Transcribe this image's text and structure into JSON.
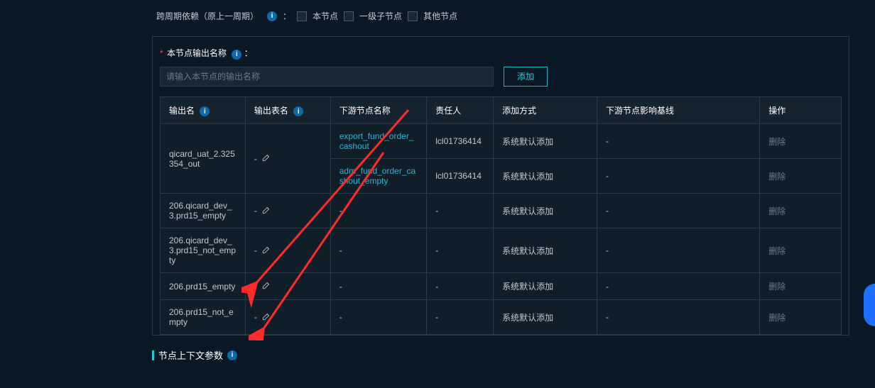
{
  "dep": {
    "label": "跨周期依赖（原上一周期）",
    "opts": [
      "本节点",
      "一级子节点",
      "其他节点"
    ]
  },
  "output": {
    "title": "本节点输出名称",
    "placeholder": "请输入本节点的输出名称",
    "add": "添加",
    "headers": {
      "outname": "输出名",
      "outtable": "输出表名",
      "downnode": "下游节点名称",
      "owner": "责任人",
      "addmode": "添加方式",
      "baseline": "下游节点影响基线",
      "op": "操作"
    },
    "op_delete": "删除",
    "rows": [
      {
        "outname": "qicard_uat_2.325354_out",
        "outtable": "-",
        "down": [
          {
            "node": "export_fund_order_cashout",
            "owner": "lcl01736414",
            "addmode": "系统默认添加",
            "baseline": "-"
          },
          {
            "node": "adm_fund_order_cashout_empty",
            "owner": "lcl01736414",
            "addmode": "系统默认添加",
            "baseline": "-"
          }
        ]
      },
      {
        "outname": "206.qicard_dev_3.prd15_empty",
        "outtable": "-",
        "down": [
          {
            "node": "-",
            "owner": "-",
            "addmode": "系统默认添加",
            "baseline": "-"
          }
        ]
      },
      {
        "outname": "206.qicard_dev_3.prd15_not_empty",
        "outtable": "-",
        "down": [
          {
            "node": "-",
            "owner": "-",
            "addmode": "系统默认添加",
            "baseline": "-"
          }
        ]
      },
      {
        "outname": "206.prd15_empty",
        "outtable": "-",
        "down": [
          {
            "node": "-",
            "owner": "-",
            "addmode": "系统默认添加",
            "baseline": "-"
          }
        ]
      },
      {
        "outname": "206.prd15_not_empty",
        "outtable": "-",
        "down": [
          {
            "node": "-",
            "owner": "-",
            "addmode": "系统默认添加",
            "baseline": "-"
          }
        ]
      }
    ]
  },
  "footer": {
    "title": "节点上下文参数"
  }
}
